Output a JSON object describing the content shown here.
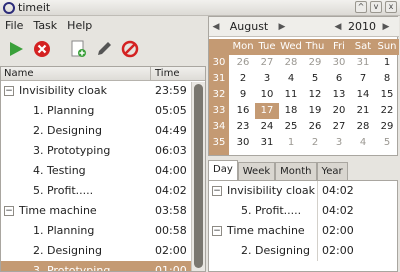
{
  "window": {
    "title": "timeit",
    "controls": [
      "^",
      "v",
      "x"
    ]
  },
  "menu": [
    "File",
    "Task",
    "Help"
  ],
  "toolbar": {
    "icons": [
      "start-icon",
      "stop-icon",
      "add-task-icon",
      "edit-icon",
      "delete-icon"
    ],
    "colors": {
      "start": "#3aa03a",
      "stop": "#d42222",
      "delete": "#d42222"
    }
  },
  "tree": {
    "col_name": "Name",
    "col_time": "Time",
    "rows": [
      {
        "label": "Invisibility cloak",
        "time": "23:59",
        "parent": true
      },
      {
        "label": "1. Planning",
        "time": "05:05",
        "parent": false
      },
      {
        "label": "2. Designing",
        "time": "04:49",
        "parent": false
      },
      {
        "label": "3. Prototyping",
        "time": "06:03",
        "parent": false
      },
      {
        "label": "4. Testing",
        "time": "04:00",
        "parent": false
      },
      {
        "label": "5. Profit.....",
        "time": "04:02",
        "parent": false
      },
      {
        "label": "Time machine",
        "time": "03:58",
        "parent": true
      },
      {
        "label": "1. Planning",
        "time": "00:58",
        "parent": false
      },
      {
        "label": "2. Designing",
        "time": "02:00",
        "parent": false
      },
      {
        "label": "3. Prototyping",
        "time": "01:00",
        "parent": false,
        "selected": true
      }
    ]
  },
  "calendar": {
    "month": "August",
    "year": "2010",
    "days": [
      "Mon",
      "Tue",
      "Wed",
      "Thu",
      "Fri",
      "Sat",
      "Sun"
    ],
    "weeks": [
      {
        "week": "30",
        "dates": [
          "26",
          "27",
          "28",
          "29",
          "30",
          "31",
          "1"
        ],
        "muted": [
          true,
          true,
          true,
          true,
          true,
          true,
          false
        ]
      },
      {
        "week": "31",
        "dates": [
          "2",
          "3",
          "4",
          "5",
          "6",
          "7",
          "8"
        ],
        "muted": [
          false,
          false,
          false,
          false,
          false,
          false,
          false
        ]
      },
      {
        "week": "32",
        "dates": [
          "9",
          "10",
          "11",
          "12",
          "13",
          "14",
          "15"
        ],
        "muted": [
          false,
          false,
          false,
          false,
          false,
          false,
          false
        ]
      },
      {
        "week": "33",
        "dates": [
          "16",
          "17",
          "18",
          "19",
          "20",
          "21",
          "22"
        ],
        "muted": [
          false,
          false,
          false,
          false,
          false,
          false,
          false
        ]
      },
      {
        "week": "34",
        "dates": [
          "23",
          "24",
          "25",
          "26",
          "27",
          "28",
          "29"
        ],
        "muted": [
          false,
          false,
          false,
          false,
          false,
          false,
          false
        ]
      },
      {
        "week": "35",
        "dates": [
          "30",
          "31",
          "1",
          "2",
          "3",
          "4",
          "5"
        ],
        "muted": [
          false,
          false,
          true,
          true,
          true,
          true,
          true
        ]
      }
    ],
    "selected_date": "17",
    "accent": "#c49a73"
  },
  "tabs": [
    "Day",
    "Week",
    "Month",
    "Year"
  ],
  "active_tab": "Day",
  "details": {
    "rows": [
      {
        "label": "Invisibility cloak",
        "time": "04:02",
        "parent": true
      },
      {
        "label": "5. Profit.....",
        "time": "04:02",
        "parent": false
      },
      {
        "label": "Time machine",
        "time": "02:00",
        "parent": true
      },
      {
        "label": "2. Designing",
        "time": "02:00",
        "parent": false
      }
    ]
  }
}
